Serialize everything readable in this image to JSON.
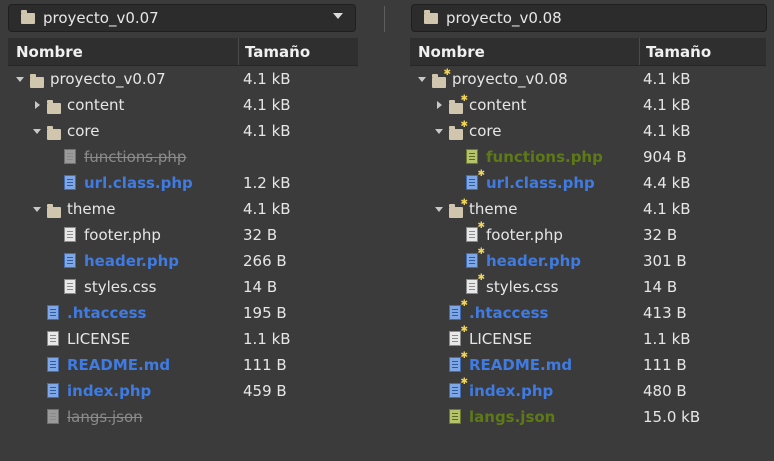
{
  "left": {
    "location": "proyecto_v0.07",
    "columns": {
      "name": "Nombre",
      "size": "Tamaño"
    },
    "rows": [
      {
        "depth": 0,
        "expander": "down",
        "type": "folder",
        "name": "proyecto_v0.07",
        "size": "4.1 kB",
        "status": "normal"
      },
      {
        "depth": 1,
        "expander": "right",
        "type": "folder",
        "name": "content",
        "size": "4.1 kB",
        "status": "normal"
      },
      {
        "depth": 1,
        "expander": "down",
        "type": "folder",
        "name": "core",
        "size": "4.1 kB",
        "status": "normal"
      },
      {
        "depth": 2,
        "expander": "none",
        "type": "file",
        "name": "functions.php",
        "size": "",
        "status": "removed"
      },
      {
        "depth": 2,
        "expander": "none",
        "type": "file",
        "name": "url.class.php",
        "size": "1.2 kB",
        "status": "changed"
      },
      {
        "depth": 1,
        "expander": "down",
        "type": "folder",
        "name": "theme",
        "size": "4.1 kB",
        "status": "normal"
      },
      {
        "depth": 2,
        "expander": "none",
        "type": "file",
        "name": "footer.php",
        "size": "32 B",
        "status": "normal"
      },
      {
        "depth": 2,
        "expander": "none",
        "type": "file",
        "name": "header.php",
        "size": "266 B",
        "status": "changed"
      },
      {
        "depth": 2,
        "expander": "none",
        "type": "file",
        "name": "styles.css",
        "size": "14 B",
        "status": "normal"
      },
      {
        "depth": 1,
        "expander": "none",
        "type": "file",
        "name": ".htaccess",
        "size": "195 B",
        "status": "changed"
      },
      {
        "depth": 1,
        "expander": "none",
        "type": "file",
        "name": "LICENSE",
        "size": "1.1 kB",
        "status": "normal"
      },
      {
        "depth": 1,
        "expander": "none",
        "type": "file",
        "name": "README.md",
        "size": "111 B",
        "status": "changed"
      },
      {
        "depth": 1,
        "expander": "none",
        "type": "file",
        "name": "index.php",
        "size": "459 B",
        "status": "changed"
      },
      {
        "depth": 1,
        "expander": "none",
        "type": "file",
        "name": "langs.json",
        "size": "",
        "status": "removed"
      }
    ]
  },
  "right": {
    "location": "proyecto_v0.08",
    "columns": {
      "name": "Nombre",
      "size": "Tamaño"
    },
    "rows": [
      {
        "depth": 0,
        "expander": "down",
        "type": "folder",
        "name": "proyecto_v0.08",
        "size": "4.1 kB",
        "status": "normal",
        "star": true
      },
      {
        "depth": 1,
        "expander": "right",
        "type": "folder",
        "name": "content",
        "size": "4.1 kB",
        "status": "normal",
        "star": true
      },
      {
        "depth": 1,
        "expander": "down",
        "type": "folder",
        "name": "core",
        "size": "4.1 kB",
        "status": "normal",
        "star": true
      },
      {
        "depth": 2,
        "expander": "none",
        "type": "file",
        "name": "functions.php",
        "size": "904 B",
        "status": "added",
        "star": false
      },
      {
        "depth": 2,
        "expander": "none",
        "type": "file",
        "name": "url.class.php",
        "size": "4.4 kB",
        "status": "changed",
        "star": true
      },
      {
        "depth": 1,
        "expander": "down",
        "type": "folder",
        "name": "theme",
        "size": "4.1 kB",
        "status": "normal",
        "star": true
      },
      {
        "depth": 2,
        "expander": "none",
        "type": "file",
        "name": "footer.php",
        "size": "32 B",
        "status": "normal",
        "star": true
      },
      {
        "depth": 2,
        "expander": "none",
        "type": "file",
        "name": "header.php",
        "size": "301 B",
        "status": "changed",
        "star": true
      },
      {
        "depth": 2,
        "expander": "none",
        "type": "file",
        "name": "styles.css",
        "size": "14 B",
        "status": "normal",
        "star": true
      },
      {
        "depth": 1,
        "expander": "none",
        "type": "file",
        "name": ".htaccess",
        "size": "413 B",
        "status": "changed",
        "star": true
      },
      {
        "depth": 1,
        "expander": "none",
        "type": "file",
        "name": "LICENSE",
        "size": "1.1 kB",
        "status": "normal",
        "star": true
      },
      {
        "depth": 1,
        "expander": "none",
        "type": "file",
        "name": "README.md",
        "size": "111 B",
        "status": "changed",
        "star": true
      },
      {
        "depth": 1,
        "expander": "none",
        "type": "file",
        "name": "index.php",
        "size": "480 B",
        "status": "changed",
        "star": true
      },
      {
        "depth": 1,
        "expander": "none",
        "type": "file",
        "name": "langs.json",
        "size": "15.0 kB",
        "status": "added",
        "star": false
      }
    ]
  },
  "colors": {
    "background": "#3b3b3b",
    "changed": "#3f7be0",
    "added": "#5d7a17",
    "removed": "#8a8a8a"
  }
}
